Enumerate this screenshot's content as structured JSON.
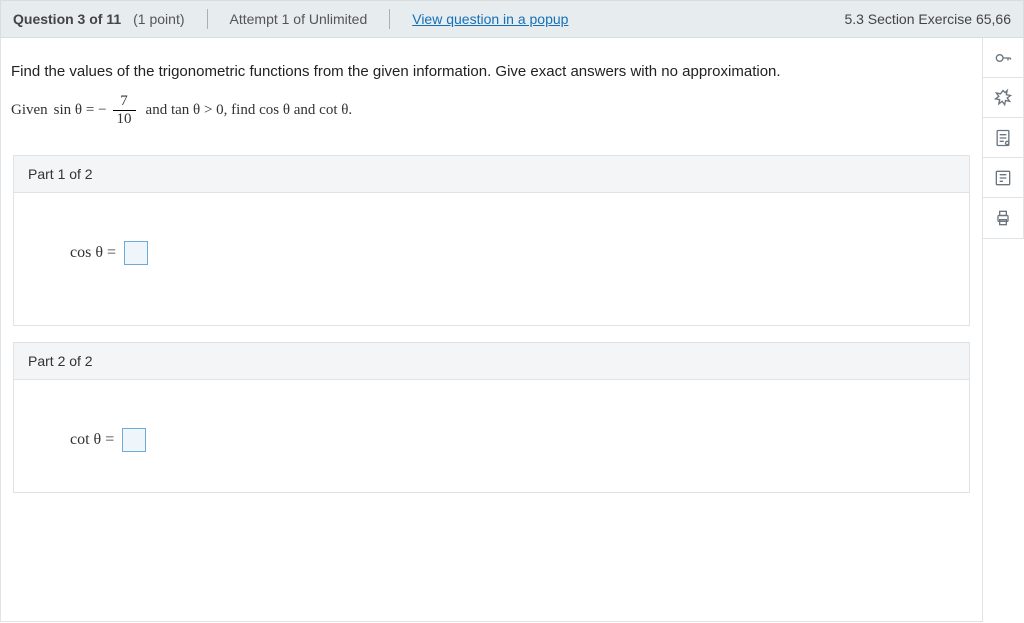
{
  "header": {
    "question_label": "Question 3 of 11",
    "points": "(1 point)",
    "attempt": "Attempt 1 of Unlimited",
    "popup_link": "View question in a popup",
    "section_ref": "5.3 Section Exercise 65,66"
  },
  "problem": {
    "instruction": "Find the values of the trigonometric functions from the given information. Give exact answers with no approximation.",
    "given_prefix": "Given",
    "sin_label": "sin θ = −",
    "frac_num": "7",
    "frac_den": "10",
    "given_suffix": "and  tan θ > 0,  find  cos θ  and  cot θ."
  },
  "parts": [
    {
      "title": "Part 1 of 2",
      "label": "cos θ  ="
    },
    {
      "title": "Part 2 of 2",
      "label": "cot θ  ="
    }
  ],
  "tools": {
    "key": "key-icon",
    "hint": "hint-icon",
    "notes": "notes-icon",
    "guided": "guided-icon",
    "print": "print-icon"
  }
}
